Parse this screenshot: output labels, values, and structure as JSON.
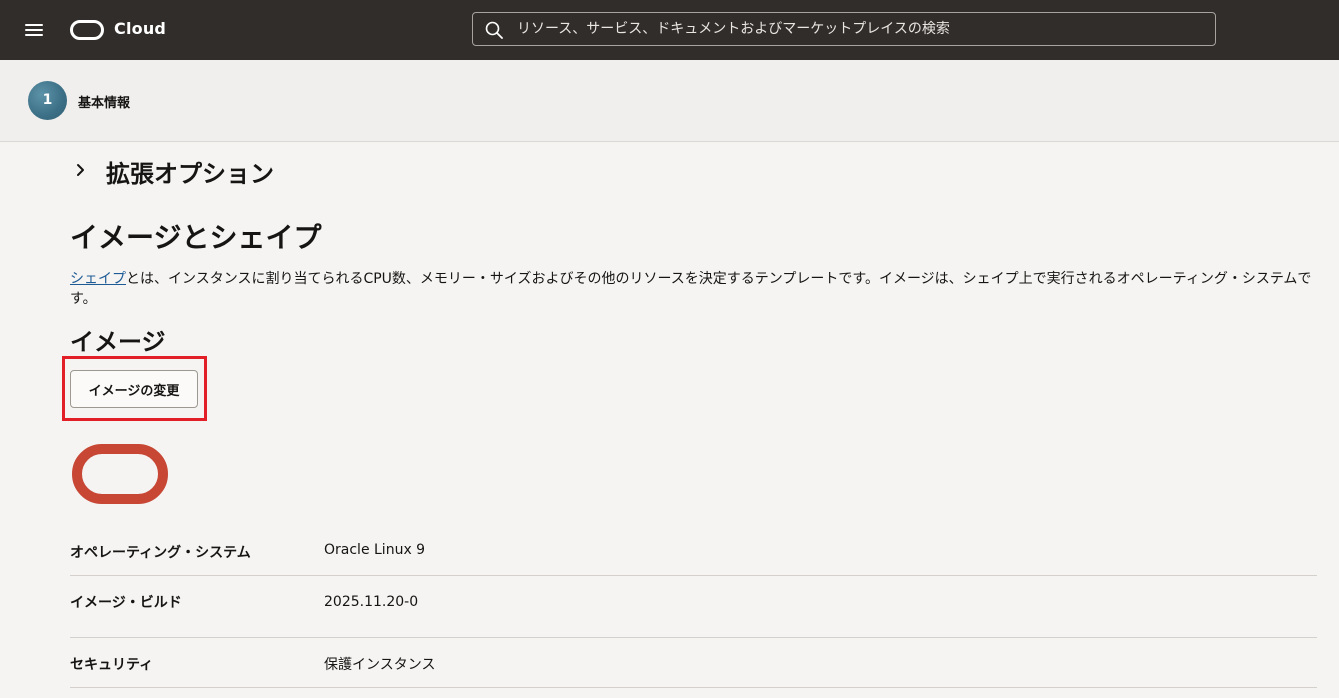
{
  "header": {
    "brand": "Cloud",
    "search_placeholder": "リソース、サービス、ドキュメントおよびマーケットプレイスの検索"
  },
  "steps": {
    "current_number": "1",
    "current_label": "基本情報"
  },
  "advanced": {
    "title": "拡張オプション"
  },
  "image_shape": {
    "title": "イメージとシェイプ",
    "desc_link": "シェイプ",
    "desc_text": "とは、インスタンスに割り当てられるCPU数、メモリー・サイズおよびその他のリソースを決定するテンプレートです。イメージは、シェイプ上で実行されるオペレーティング・システムです。"
  },
  "image": {
    "title": "イメージ",
    "change_button": "イメージの変更",
    "details": [
      {
        "label": "オペレーティング・システム",
        "value": "Oracle Linux 9"
      },
      {
        "label": "イメージ・ビルド",
        "value": "2025.11.20-0"
      },
      {
        "label": "セキュリティ",
        "value": "保護インスタンス"
      }
    ]
  },
  "colors": {
    "topbar": "#312d2a",
    "oracle_red": "#c74634",
    "highlight": "#e21f26",
    "link": "#1e5b95"
  }
}
